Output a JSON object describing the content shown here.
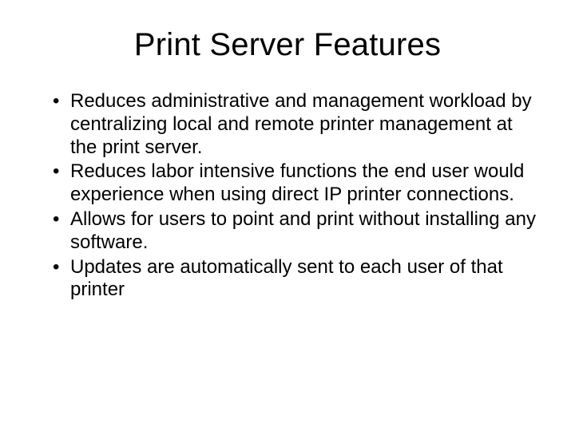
{
  "slide": {
    "title": "Print Server Features",
    "bullets": [
      "Reduces administrative and management workload by centralizing local and remote printer management at the print server.",
      "Reduces labor intensive functions the end user would experience when using direct IP printer connections.",
      "Allows for users to point and print without installing any software.",
      "Updates are automatically sent to each user of that printer"
    ]
  }
}
